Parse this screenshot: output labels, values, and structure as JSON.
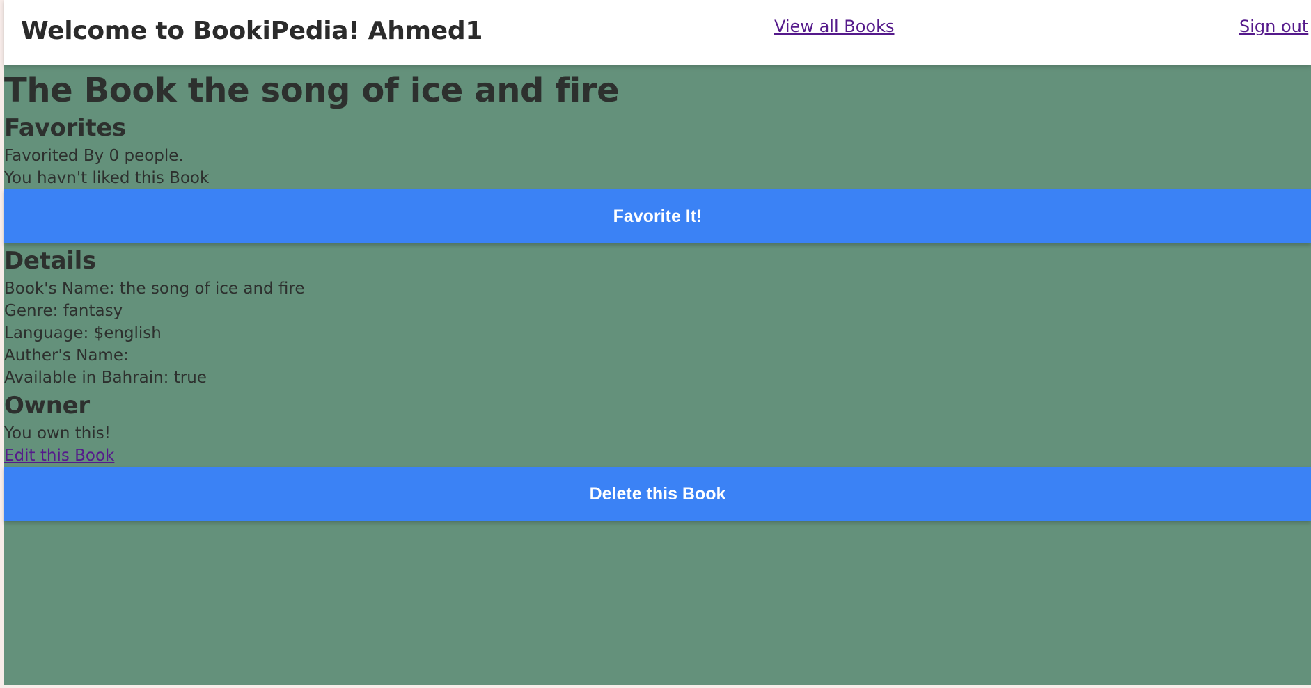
{
  "header": {
    "title": "Welcome to BookiPedia! Ahmed1",
    "view_all_label": "View all Books",
    "signout_label": "Sign out"
  },
  "book": {
    "title": "The Book the song of ice and fire"
  },
  "favorites": {
    "heading": "Favorites",
    "count_text": "Favorited By 0 people.",
    "status_text": "You havn't liked this Book",
    "button_label": "Favorite It!"
  },
  "details": {
    "heading": "Details",
    "name_line": "Book's Name: the song of ice and fire",
    "genre_line": "Genre: fantasy",
    "language_line": "Language: $english",
    "author_line": "Auther's Name:",
    "availability_line": "Available in Bahrain: true"
  },
  "owner": {
    "heading": "Owner",
    "status_text": "You own this!",
    "edit_label": "Edit this Book",
    "delete_label": "Delete this Book"
  },
  "colors": {
    "page_background": "#64917b",
    "button_blue": "#3b82f5",
    "link_purple": "#551a8b"
  }
}
